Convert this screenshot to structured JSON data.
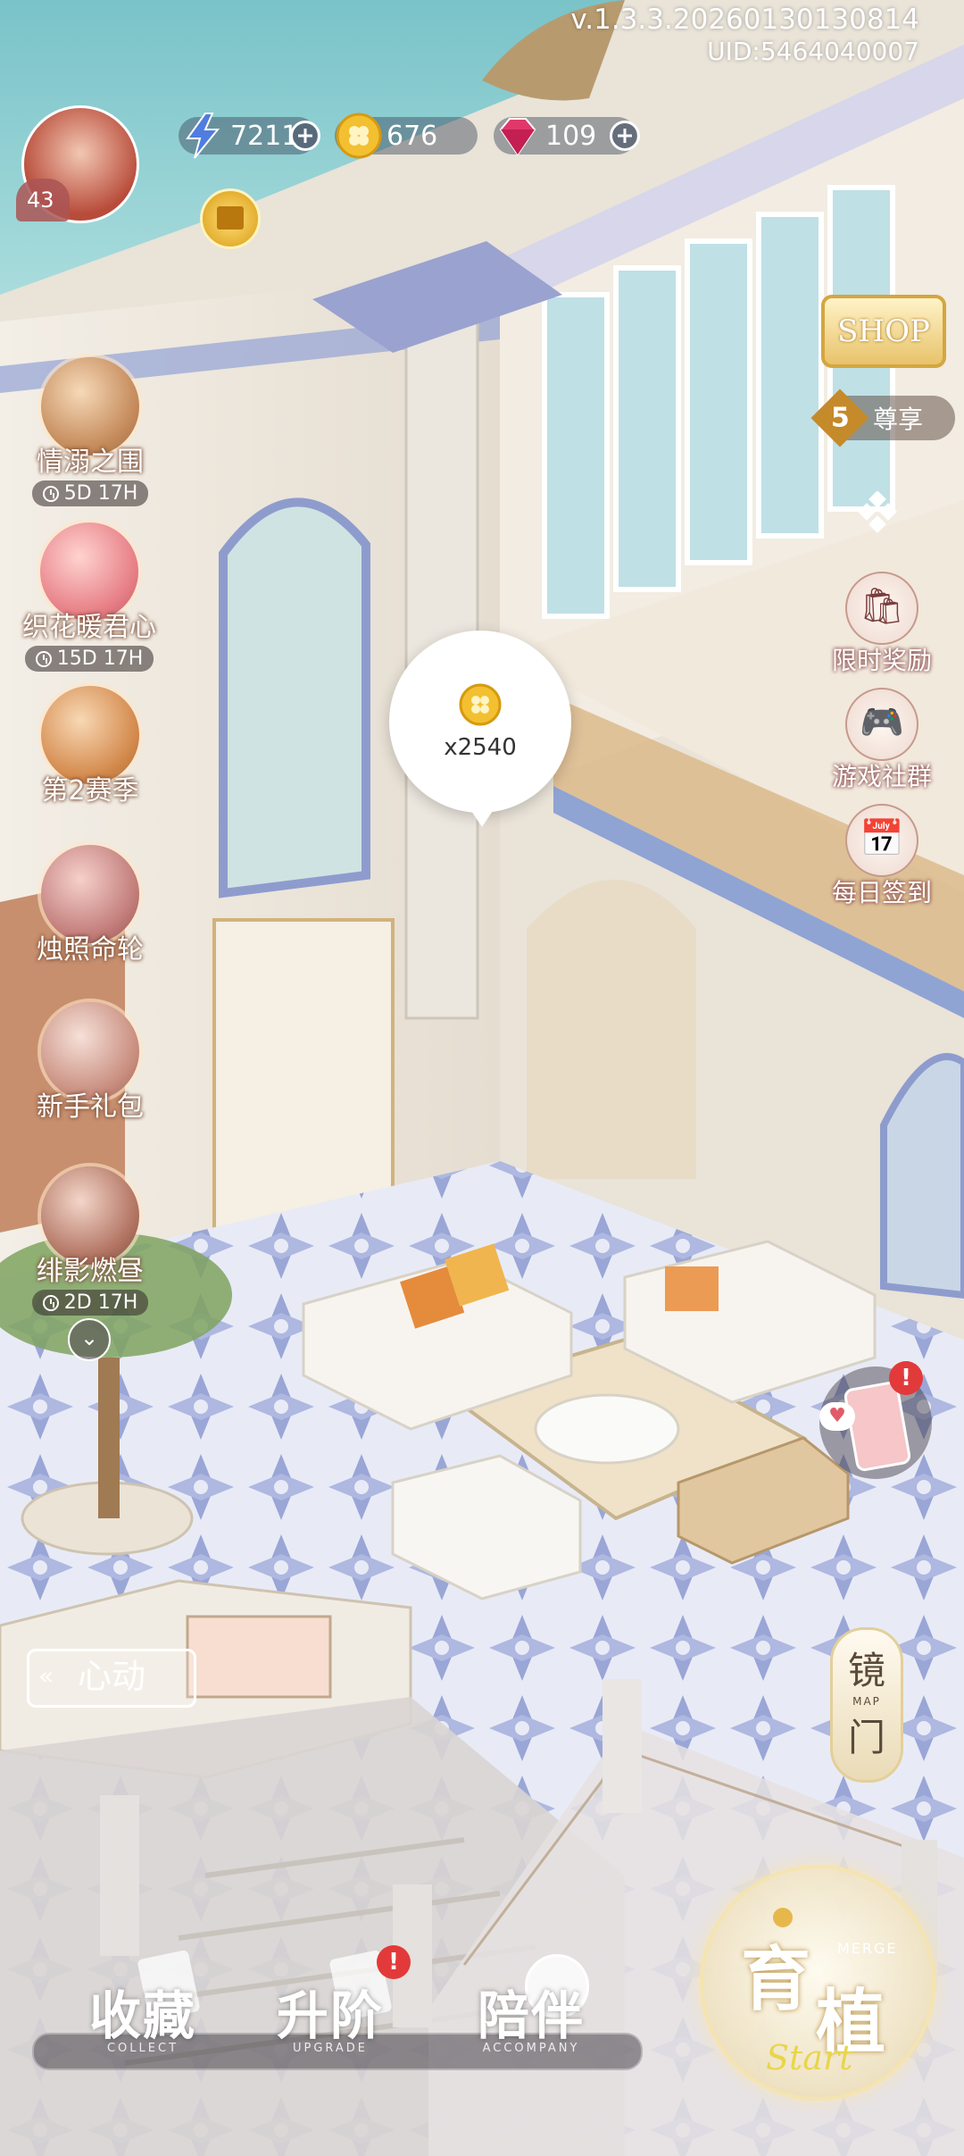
{
  "header": {
    "version": "v.1.3.3.20260130130814",
    "uid": "UID:5464040007",
    "player_level": "43"
  },
  "resources": {
    "energy": "7211",
    "coins": "676",
    "gems": "109"
  },
  "left_events": [
    {
      "name": "情溺之围",
      "timer": "5D 17H"
    },
    {
      "name": "织花暖君心",
      "timer": "15D 17H"
    },
    {
      "name": "第2赛季",
      "timer": ""
    },
    {
      "name": "烛照命轮",
      "timer": ""
    },
    {
      "name": "新手礼包",
      "timer": ""
    },
    {
      "name": "绯影燃昼",
      "timer": "2D 17H"
    }
  ],
  "right_menu": {
    "shop_label": "SHOP",
    "vip_level": "5",
    "vip_label": "尊享",
    "items": [
      {
        "label": "限时奖励",
        "icon": "gift-bag-icon"
      },
      {
        "label": "游戏社群",
        "icon": "gamepad-icon"
      },
      {
        "label": "每日签到",
        "icon": "calendar-icon"
      }
    ]
  },
  "coin_bubble": {
    "amount": "x2540"
  },
  "heart_side": {
    "label": "心动"
  },
  "mirror_gate": {
    "label_top": "镜",
    "label_bottom": "门",
    "sub": "MAP"
  },
  "bottom_nav": [
    {
      "label": "收藏",
      "sub": "COLLECT",
      "badge": false
    },
    {
      "label": "升阶",
      "sub": "UPGRADE",
      "badge": true
    },
    {
      "label": "陪伴",
      "sub": "ACCOMPANY",
      "badge": false
    }
  ],
  "start_button": {
    "big_top": "育",
    "big_bottom": "植",
    "merge": "MERGE",
    "script": "Start"
  },
  "colors": {
    "accent_gold": "#e6b84c",
    "badge_red": "#e23a3a",
    "sea": "#7fc9cf",
    "floor_tile": "#b9c2e3"
  }
}
